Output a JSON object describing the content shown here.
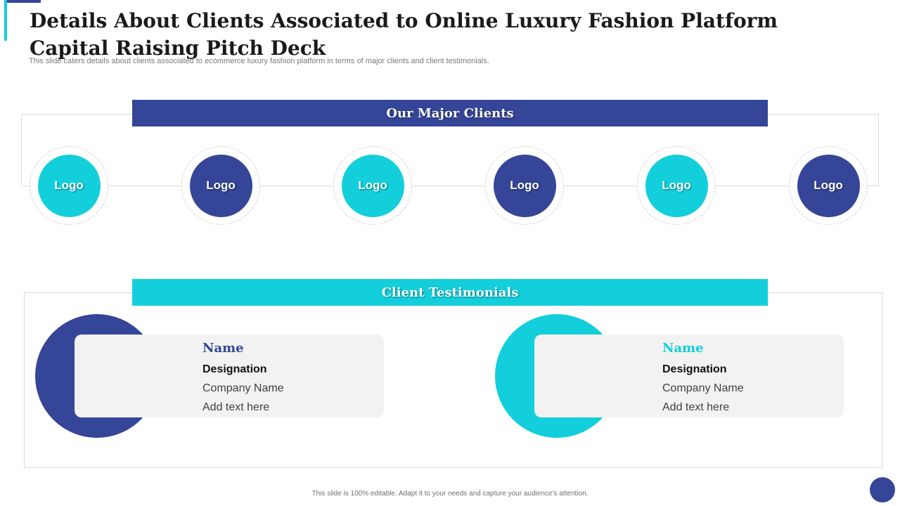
{
  "slide": {
    "title": "Details About Clients Associated to Online Luxury Fashion Platform Capital Raising Pitch Deck",
    "subtitle": "This slide caters details about clients associated to ecommerce luxury fashion platform in terms of major clients and client testimonials.",
    "footer": "This slide is 100% editable.  Adapt it to your needs and capture your audience’s attention."
  },
  "colors": {
    "navy": "#354598",
    "teal": "#12cfdb"
  },
  "major_clients": {
    "heading": "Our Major Clients",
    "logos": [
      {
        "label": "Logo",
        "color": "teal"
      },
      {
        "label": "Logo",
        "color": "navy"
      },
      {
        "label": "Logo",
        "color": "teal"
      },
      {
        "label": "Logo",
        "color": "navy"
      },
      {
        "label": "Logo",
        "color": "teal"
      },
      {
        "label": "Logo",
        "color": "navy"
      }
    ]
  },
  "testimonials": {
    "heading": "Client Testimonials",
    "items": [
      {
        "name": "Name",
        "designation": "Designation",
        "company": "Company Name",
        "text": "Add text here",
        "color": "navy"
      },
      {
        "name": "Name",
        "designation": "Designation",
        "company": "Company Name",
        "text": "Add text here",
        "color": "teal"
      }
    ]
  }
}
